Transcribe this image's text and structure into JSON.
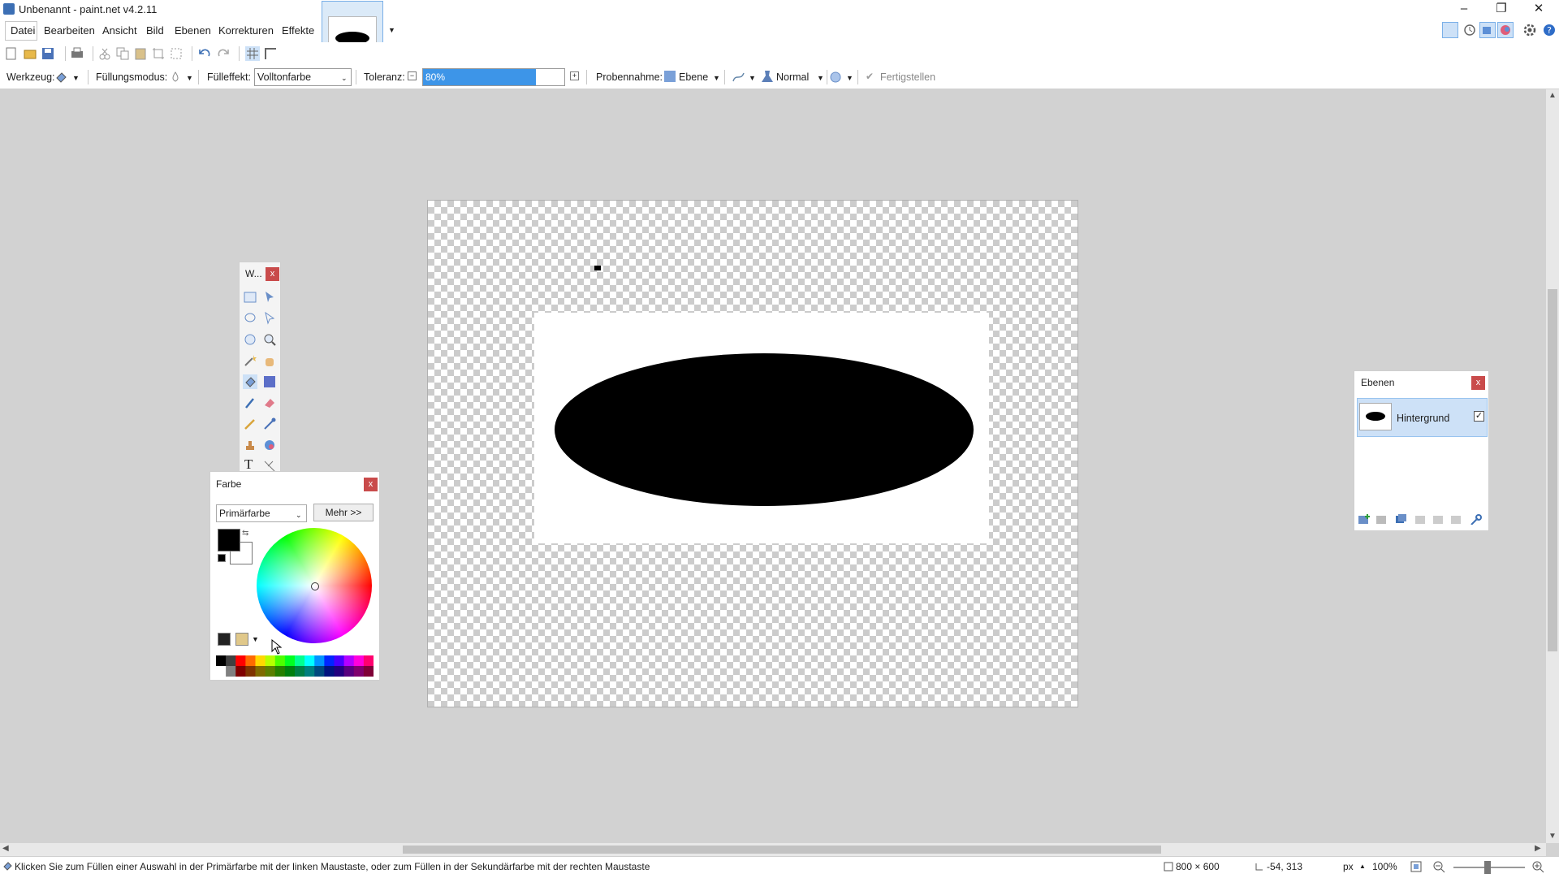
{
  "window": {
    "title": "Unbenannt - paint.net v4.2.11",
    "minimize": "–",
    "restore": "❐",
    "close": "✕"
  },
  "menu": {
    "items": [
      "Datei",
      "Bearbeiten",
      "Ansicht",
      "Bild",
      "Ebenen",
      "Korrekturen",
      "Effekte"
    ]
  },
  "toolbar2": {
    "tool_label": "Werkzeug:",
    "fill_mode_label": "Füllungsmodus:",
    "fill_effect_label": "Fülleffekt:",
    "fill_effect_value": "Volltonfarbe",
    "tolerance_label": "Toleranz:",
    "tolerance_value": "80%",
    "tolerance_fraction": 0.8,
    "sampling_label": "Probennahme:",
    "sampling_value": "Ebene",
    "blend_value": "Normal",
    "finish_label": "Fertigstellen"
  },
  "tools_window": {
    "title": "W...",
    "close": "x"
  },
  "colors_window": {
    "title": "Farbe",
    "close": "x",
    "select_value": "Primärfarbe",
    "more_button": "Mehr >>",
    "primary_color": "#000000",
    "secondary_color": "#ffffff"
  },
  "layers_window": {
    "title": "Ebenen",
    "close": "x",
    "layer_name": "Hintergrund",
    "layer_visible": true
  },
  "status": {
    "hint": "Klicken Sie zum Füllen einer Auswahl in der Primärfarbe mit der linken Maustaste, oder zum Füllen in der Sekundärfarbe mit der rechten Maustaste",
    "image_size": "800 × 600",
    "cursor_pos": "-54, 313",
    "unit": "px",
    "zoom": "100%"
  },
  "colors": {
    "accent": "#3c6fb4",
    "selection": "#cde1f7",
    "close_red": "#c94b4b"
  }
}
